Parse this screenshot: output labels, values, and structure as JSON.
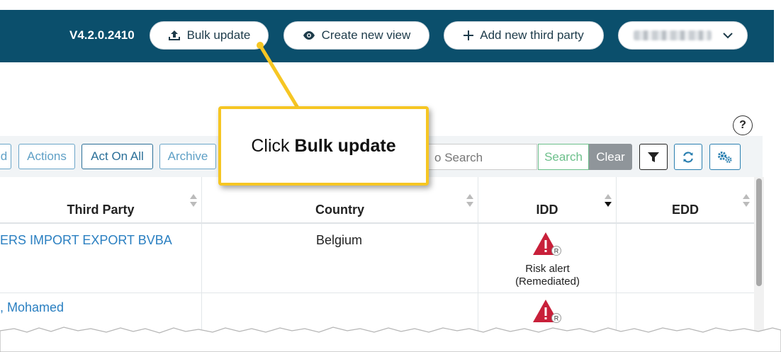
{
  "header": {
    "version": "V4.2.0.2410",
    "buttons": [
      {
        "label": "Bulk update",
        "icon": "upload-icon"
      },
      {
        "label": "Create new view",
        "icon": "eye-icon"
      },
      {
        "label": "Add new third party",
        "icon": "plus-icon"
      }
    ],
    "user_menu_icon": "chevron-down-icon"
  },
  "help": {
    "label": "?"
  },
  "toolbar": {
    "partial_left": "d",
    "actions": "Actions",
    "act_on_all": "Act On All",
    "archive": "Archive",
    "search_placeholder": "Search",
    "search_prefix": "o",
    "search_button": "Search",
    "clear_button": "Clear"
  },
  "table": {
    "columns": [
      "Third Party",
      "Country",
      "IDD",
      "EDD"
    ],
    "rows": [
      {
        "third_party": "ERS IMPORT EXPORT BVBA",
        "country": "Belgium",
        "idd_status": "Risk alert",
        "idd_substatus": "(Remediated)",
        "edd": ""
      },
      {
        "third_party": ", Mohamed",
        "country": "",
        "idd_status": "",
        "idd_substatus": "",
        "edd": ""
      }
    ],
    "badge_letter": "R"
  },
  "callout": {
    "prefix": "Click",
    "bold": "Bulk update"
  },
  "colors": {
    "header_bg": "#0b4f6c",
    "callout_border": "#f6c623",
    "link": "#2a7fc1",
    "alert": "#c8203a"
  }
}
